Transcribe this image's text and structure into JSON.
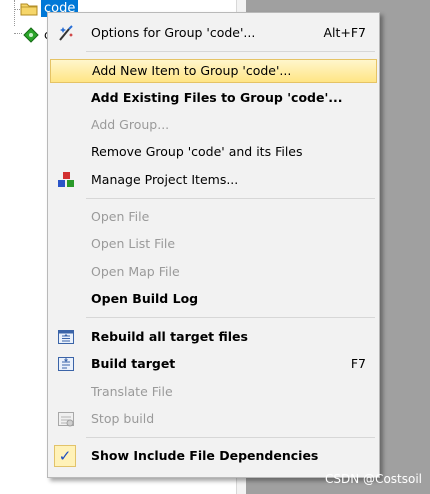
{
  "tree": {
    "selected_group": "code",
    "child_label": "c"
  },
  "menu": {
    "items": [
      {
        "label": "Options for Group 'code'...",
        "shortcut": "Alt+F7",
        "icon": "options-wand-icon"
      },
      {
        "label": "Add New  Item to Group 'code'...",
        "icon": ""
      },
      {
        "label": "Add Existing Files to Group 'code'...",
        "icon": ""
      },
      {
        "label": "Add Group...",
        "icon": ""
      },
      {
        "label": "Remove Group 'code' and its Files",
        "icon": ""
      },
      {
        "label": "Manage Project Items...",
        "icon": "manage-project-icon"
      },
      {
        "label": "Open File",
        "icon": ""
      },
      {
        "label": "Open List File",
        "icon": ""
      },
      {
        "label": "Open Map File",
        "icon": ""
      },
      {
        "label": "Open Build Log",
        "icon": ""
      },
      {
        "label": "Rebuild all target files",
        "icon": "rebuild-icon"
      },
      {
        "label": "Build target",
        "shortcut": "F7",
        "icon": "build-icon"
      },
      {
        "label": "Translate File",
        "icon": ""
      },
      {
        "label": "Stop build",
        "icon": "stop-build-icon"
      },
      {
        "label": "Show Include File Dependencies",
        "checked": true,
        "icon": "checkmark-icon"
      }
    ],
    "check_mark": "✓"
  },
  "watermark": "CSDN @Costsoil",
  "colors": {
    "highlight_top": "#fff6cc",
    "highlight_bottom": "#ffe585",
    "selection_blue": "#0078d7",
    "disabled_text": "#9a9a9a"
  }
}
